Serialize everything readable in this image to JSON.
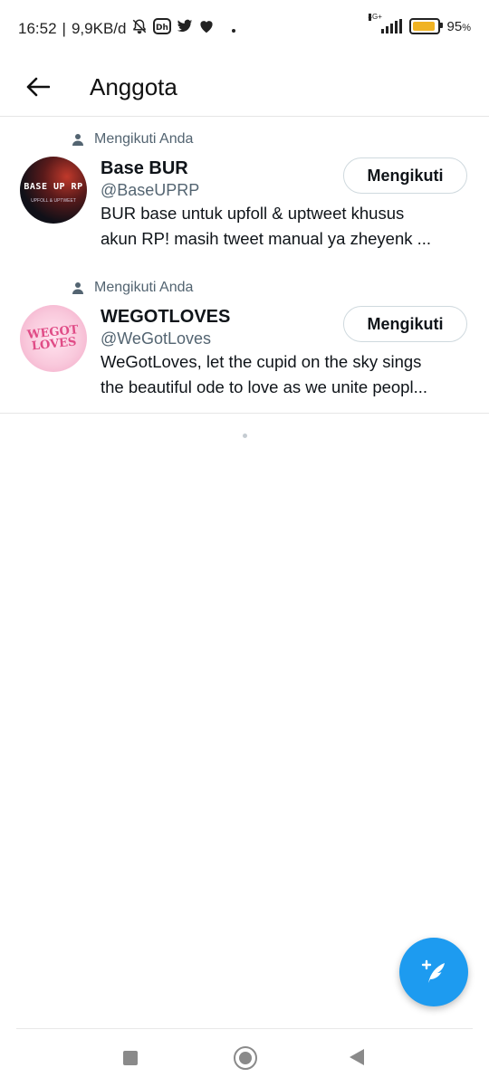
{
  "status_bar": {
    "time": "16:52",
    "speed": "9,9KB/d",
    "network_label": "4G+",
    "battery_percent_label": "95",
    "battery_unit": "%",
    "battery_level": 0.95,
    "icons": [
      "bell-off-icon",
      "disney-hotstar-icon",
      "twitter-bird-icon",
      "heart-icon",
      "dot-icon",
      "signal-icon",
      "battery-icon"
    ]
  },
  "header": {
    "title": "Anggota",
    "back_icon": "arrow-left-icon"
  },
  "members": [
    {
      "followed_label": "Mengikuti Anda",
      "name": "Base BUR",
      "handle": "@BaseUPRP",
      "bio_line1": "BUR base untuk upfoll & uptweet khusus",
      "bio_line2": "akun RP! masih tweet manual ya zheyenk ...",
      "button_label": "Mengikuti",
      "avatar_text": "BASE UP RP",
      "avatar_subtext": "UPFOLL & UPTWEET"
    },
    {
      "followed_label": "Mengikuti Anda",
      "name": "WEGOTLOVES",
      "handle": "@WeGotLoves",
      "bio_line1": "WeGotLoves, let the cupid on the sky sings",
      "bio_line2": "the beautiful ode to love as we unite peopl...",
      "button_label": "Mengikuti",
      "avatar_text_line1": "WEGOT",
      "avatar_text_line2": "LOVES"
    }
  ],
  "fab": {
    "icon": "compose-feather-icon"
  },
  "navbar": {
    "icons": [
      "recent-apps-icon",
      "home-icon",
      "back-icon"
    ]
  },
  "colors": {
    "accent": "#1d9bf0",
    "secondary_text": "#536471",
    "battery_fill": "#f0b323"
  }
}
